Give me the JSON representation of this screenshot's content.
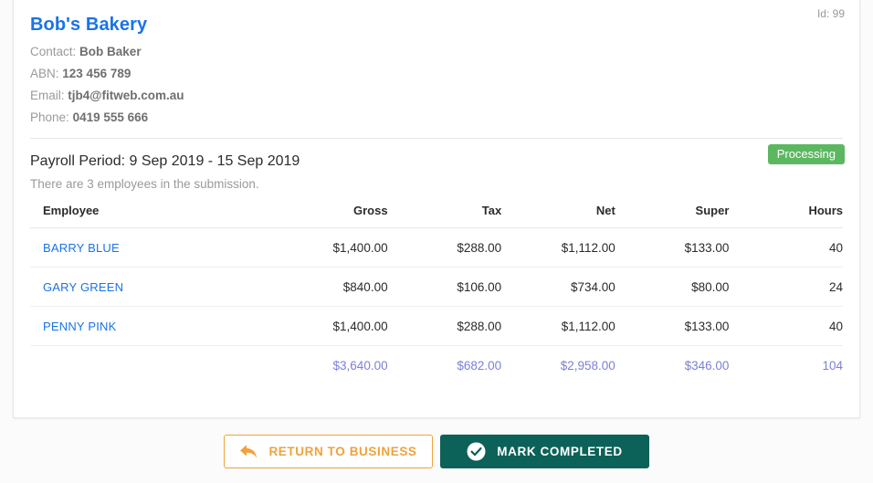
{
  "business": {
    "id_label": "Id: 99",
    "name": "Bob's Bakery",
    "contact_label": "Contact:",
    "contact_value": "Bob Baker",
    "abn_label": "ABN:",
    "abn_value": "123 456 789",
    "email_label": "Email:",
    "email_value": "tjb4@fitweb.com.au",
    "phone_label": "Phone:",
    "phone_value": "0419 555 666"
  },
  "payroll": {
    "title": "Payroll Period: 9 Sep 2019 - 15 Sep 2019",
    "subtitle": "There are 3 employees in the submission.",
    "status": "Processing",
    "status_color": "#5cb860"
  },
  "table": {
    "headers": [
      "Employee",
      "Gross",
      "Tax",
      "Net",
      "Super",
      "Hours"
    ],
    "rows": [
      {
        "employee": "BARRY BLUE",
        "gross": "$1,400.00",
        "tax": "$288.00",
        "net": "$1,112.00",
        "super": "$133.00",
        "hours": "40"
      },
      {
        "employee": "GARY GREEN",
        "gross": "$840.00",
        "tax": "$106.00",
        "net": "$734.00",
        "super": "$80.00",
        "hours": "24"
      },
      {
        "employee": "PENNY PINK",
        "gross": "$1,400.00",
        "tax": "$288.00",
        "net": "$1,112.00",
        "super": "$133.00",
        "hours": "40"
      }
    ],
    "totals": {
      "employee": "",
      "gross": "$3,640.00",
      "tax": "$682.00",
      "net": "$2,958.00",
      "super": "$346.00",
      "hours": "104"
    }
  },
  "actions": {
    "return_label": "RETURN TO BUSINESS",
    "return_icon": "reply-arrow-icon",
    "return_color": "#f0a23c",
    "complete_label": "MARK COMPLETED",
    "complete_icon": "check-circle-icon",
    "complete_color": "#0c6158"
  }
}
